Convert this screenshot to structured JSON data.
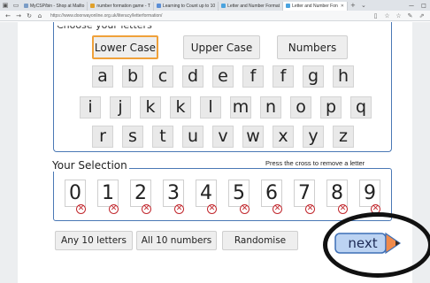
{
  "browser": {
    "tabs": [
      {
        "title": "MyCSP/bin - Shop at Mailto",
        "color": "#7a9cc6",
        "active": false
      },
      {
        "title": "number formation game - T",
        "color": "#e0a02a",
        "active": false
      },
      {
        "title": "Learning to Count up to 10",
        "color": "#5b8ed6",
        "active": false
      },
      {
        "title": "Letter and Number Format",
        "color": "#4aa3df",
        "active": false
      },
      {
        "title": "Letter and Number Fon",
        "color": "#4aa3df",
        "active": true
      }
    ],
    "url": "https://www.doorwayonline.org.uk/literacy/letterformation/"
  },
  "panel": {
    "title": "Choose your letters",
    "case_buttons": [
      {
        "label": "Lower Case",
        "selected": true
      },
      {
        "label": "Upper Case",
        "selected": false
      },
      {
        "label": "Numbers",
        "selected": false
      }
    ],
    "letter_rows": [
      [
        "a",
        "b",
        "c",
        "d",
        "e",
        "f",
        "f",
        "g",
        "h"
      ],
      [
        "i",
        "j",
        "k",
        "k",
        "l",
        "m",
        "n",
        "o",
        "p",
        "q"
      ],
      [
        "r",
        "s",
        "t",
        "u",
        "v",
        "w",
        "x",
        "y",
        "z"
      ]
    ]
  },
  "selection": {
    "title": "Your Selection",
    "hint": "Press the cross to remove a letter",
    "digits": [
      "0",
      "1",
      "2",
      "3",
      "4",
      "5",
      "6",
      "7",
      "8",
      "9"
    ]
  },
  "actions": {
    "any_letters": "Any 10 letters",
    "all_numbers": "All 10 numbers",
    "randomise": "Randomise",
    "next": "next"
  },
  "colors": {
    "panel_border": "#4a78b5",
    "selected_border": "#f0a13a",
    "remove_icon": "#c1272d",
    "next_body": "#bcd3f2",
    "next_tip": "#f08a4b"
  }
}
